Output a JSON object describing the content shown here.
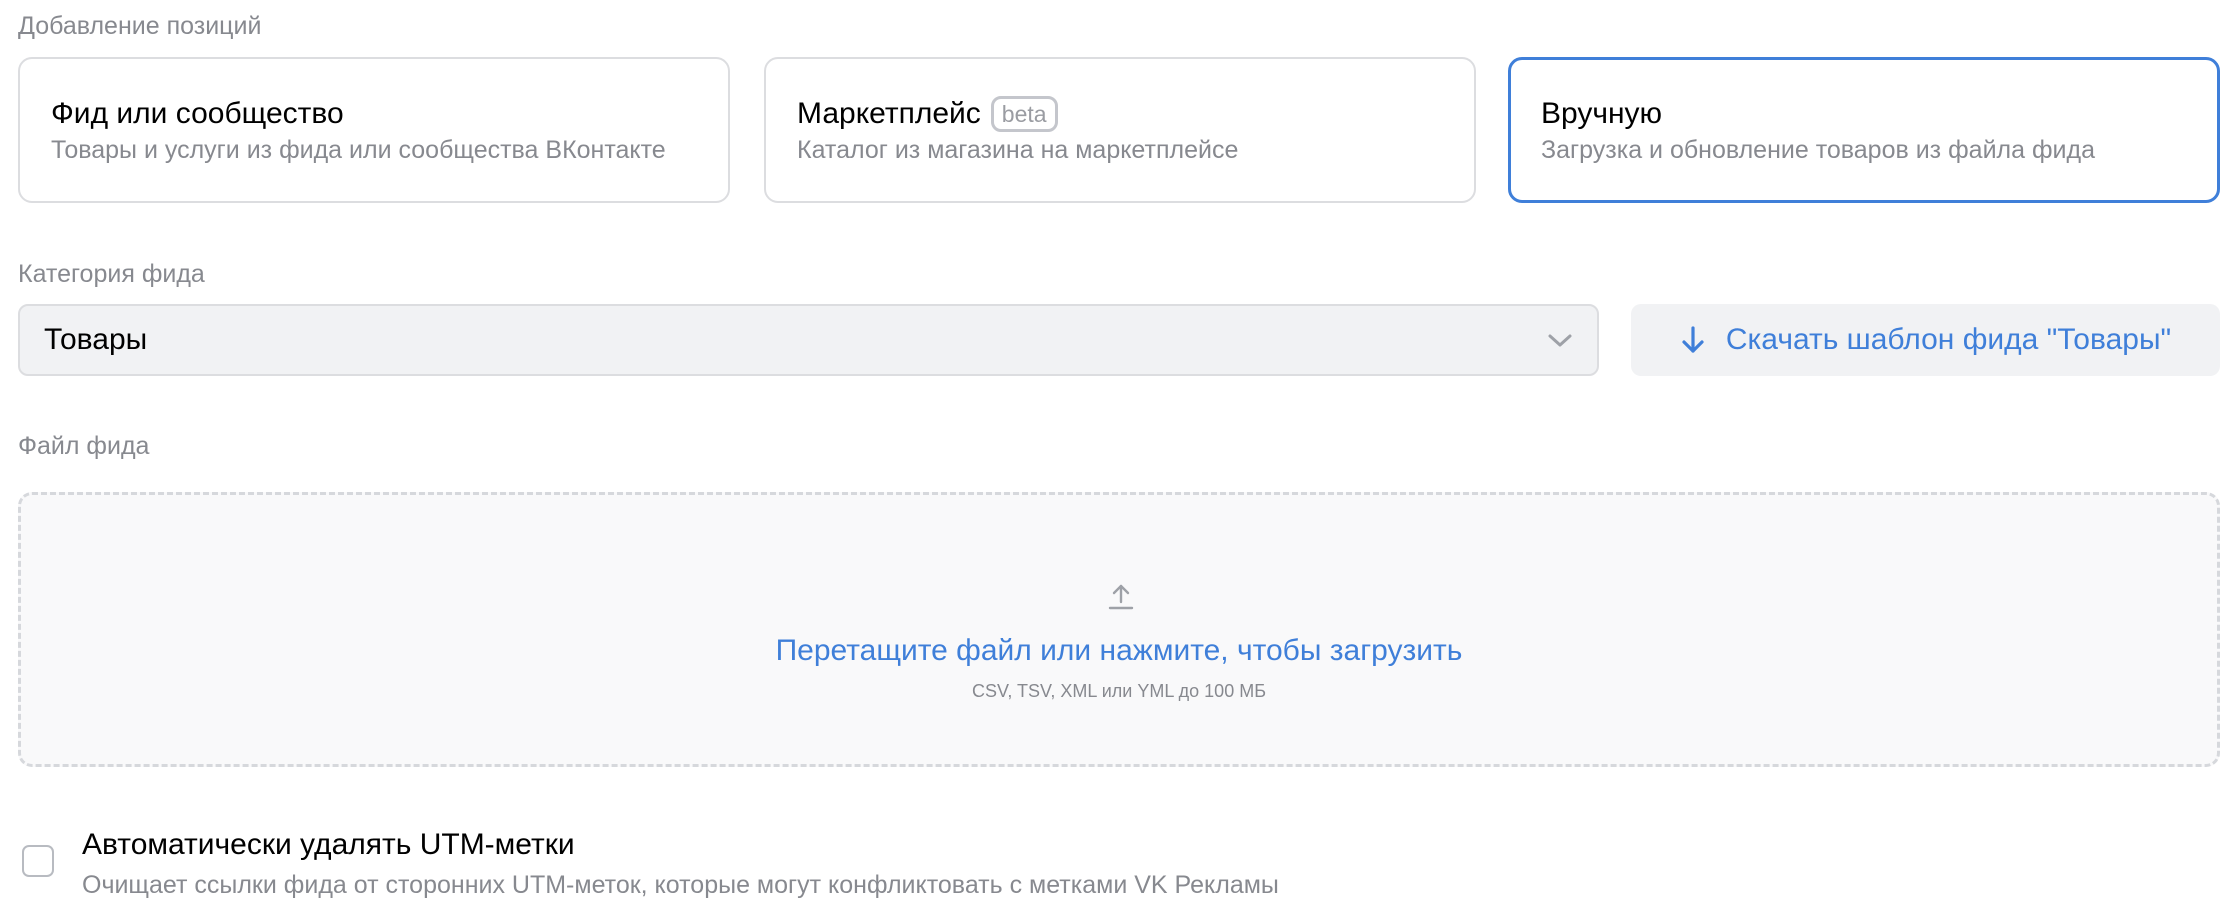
{
  "sections": {
    "add_positions_label": "Добавление позиций",
    "feed_category_label": "Категория фида",
    "feed_file_label": "Файл фида"
  },
  "sources": [
    {
      "title": "Фид или сообщество",
      "description": "Товары и услуги из фида или сообщества ВКонтакте",
      "selected": false
    },
    {
      "title": "Маркетплейс",
      "badge": "beta",
      "description": "Каталог из магазина на маркетплейсе",
      "selected": false
    },
    {
      "title": "Вручную",
      "description": "Загрузка и обновление товаров из файла фида",
      "selected": true
    }
  ],
  "category_select": {
    "value": "Товары",
    "icon": "chevron-down-icon"
  },
  "download_template": {
    "label": "Скачать шаблон фида \"Товары\"",
    "icon": "arrow-down-icon"
  },
  "dropzone": {
    "title": "Перетащите файл или нажмите, чтобы загрузить",
    "hint": "CSV, TSV, XML или YML до 100 МБ",
    "icon": "upload-icon"
  },
  "utm_option": {
    "title": "Автоматически удалять UTM-метки",
    "description": "Очищает ссылки фида от сторонних UTM-меток, которые могут конфликтовать с метками VK Рекламы",
    "checked": false
  },
  "colors": {
    "accent": "#3f7fd9",
    "muted_text": "#87898f",
    "border": "#dcdde0",
    "field_bg": "#f1f2f4"
  }
}
